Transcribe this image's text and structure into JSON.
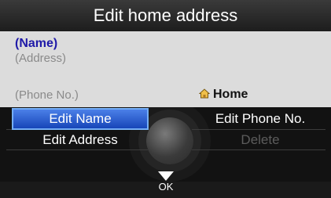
{
  "header": {
    "title": "Edit home address"
  },
  "info": {
    "name": "(Name)",
    "address": "(Address)",
    "phone": "(Phone No.)",
    "home_label": "Home"
  },
  "menu": {
    "edit_name": "Edit Name",
    "edit_phone": "Edit Phone No.",
    "edit_address": "Edit Address",
    "delete": "Delete"
  },
  "footer": {
    "ok_label": "OK"
  },
  "colors": {
    "name_text": "#1f1aa8",
    "selection": "#2f62d6",
    "menu_bg": "#121212",
    "info_bg": "#dcdcdc"
  }
}
